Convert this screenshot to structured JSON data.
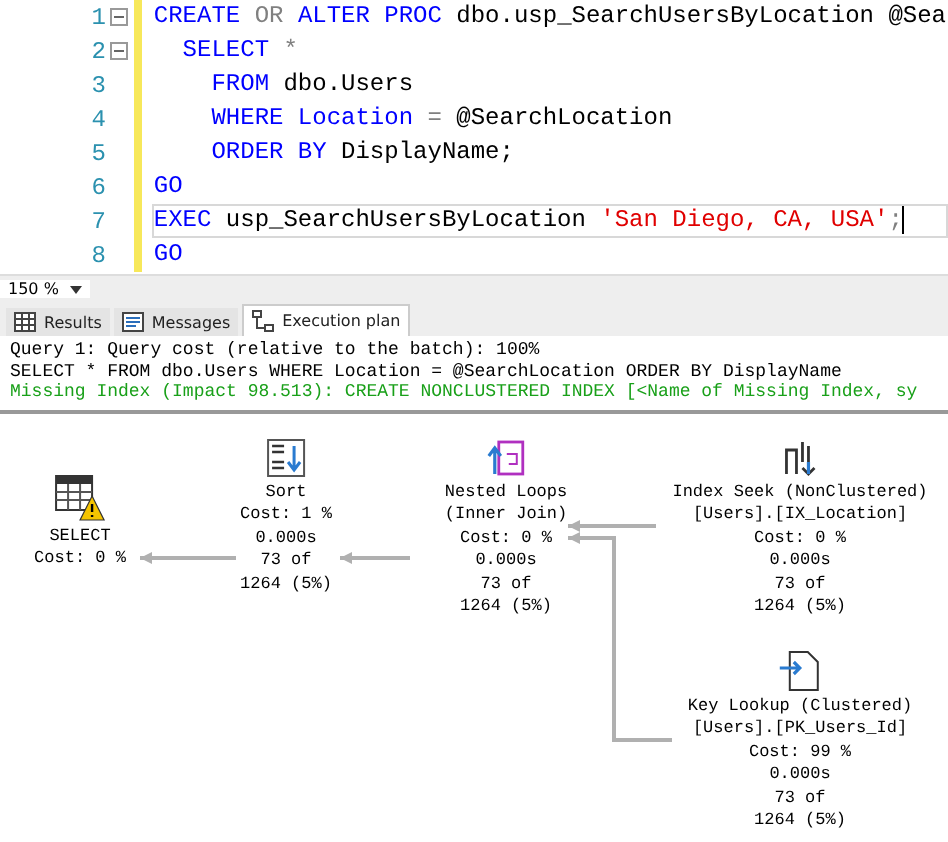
{
  "editor": {
    "lines": [
      {
        "number": "1",
        "fold": true,
        "current": false,
        "tokens": [
          {
            "kind": "keyword",
            "text": "CREATE"
          },
          {
            "kind": "operator",
            "text": " OR "
          },
          {
            "kind": "keyword",
            "text": "ALTER PROC"
          },
          {
            "kind": "plain",
            "text": " dbo.usp_SearchUsersByLocation @Sea"
          }
        ]
      },
      {
        "number": "2",
        "fold": true,
        "current": false,
        "tokens": [
          {
            "kind": "keyword",
            "text": "  SELECT"
          },
          {
            "kind": "operator",
            "text": " *"
          }
        ]
      },
      {
        "number": "3",
        "fold": false,
        "current": false,
        "tokens": [
          {
            "kind": "keyword",
            "text": "    FROM"
          },
          {
            "kind": "plain",
            "text": " dbo.Users"
          }
        ]
      },
      {
        "number": "4",
        "fold": false,
        "current": false,
        "tokens": [
          {
            "kind": "keyword",
            "text": "    WHERE Location"
          },
          {
            "kind": "operator",
            "text": " = "
          },
          {
            "kind": "plain",
            "text": "@SearchLocation"
          }
        ]
      },
      {
        "number": "5",
        "fold": false,
        "current": false,
        "tokens": [
          {
            "kind": "keyword",
            "text": "    ORDER BY"
          },
          {
            "kind": "plain",
            "text": " DisplayName;"
          }
        ]
      },
      {
        "number": "6",
        "fold": false,
        "current": false,
        "tokens": [
          {
            "kind": "keyword",
            "text": "GO"
          }
        ]
      },
      {
        "number": "7",
        "fold": false,
        "current": true,
        "tokens": [
          {
            "kind": "keyword",
            "text": "EXEC"
          },
          {
            "kind": "plain",
            "text": " usp_SearchUsersByLocation "
          },
          {
            "kind": "string",
            "text": "'San Diego, CA, USA'"
          },
          {
            "kind": "operator",
            "text": ";"
          }
        ]
      },
      {
        "number": "8",
        "fold": false,
        "current": false,
        "tokens": [
          {
            "kind": "keyword",
            "text": "GO"
          }
        ]
      }
    ]
  },
  "zoom": {
    "value": "150 %"
  },
  "tabs": [
    {
      "label": "Results",
      "selected": false
    },
    {
      "label": "Messages",
      "selected": false
    },
    {
      "label": "Execution plan",
      "selected": true
    }
  ],
  "plan_header": [
    {
      "kind": "plain",
      "text": "Query 1: Query cost (relative to the batch): 100%"
    },
    {
      "kind": "plain",
      "text": "SELECT * FROM dbo.Users WHERE Location = @SearchLocation ORDER BY DisplayName"
    },
    {
      "kind": "hint",
      "text": "Missing Index (Impact 98.513): CREATE NONCLUSTERED INDEX [<Name of Missing Index, sy"
    }
  ],
  "plan_nodes": [
    {
      "kind": "select",
      "warning": true,
      "lines": [
        "SELECT",
        "Cost: 0 %"
      ]
    },
    {
      "kind": "sort",
      "warning": false,
      "lines": [
        "Sort",
        "Cost: 1 %",
        "0.000s",
        "73 of",
        "1264 (5%)"
      ]
    },
    {
      "kind": "nested-loops",
      "warning": false,
      "lines": [
        "Nested Loops",
        "(Inner Join)",
        "Cost: 0 %",
        "0.000s",
        "73 of",
        "1264 (5%)"
      ]
    },
    {
      "kind": "index-seek",
      "warning": false,
      "lines": [
        "Index Seek (NonClustered)",
        "[Users].[IX_Location]",
        "Cost: 0 %",
        "0.000s",
        "73 of",
        "1264 (5%)"
      ]
    },
    {
      "kind": "key-lookup",
      "warning": false,
      "lines": [
        "Key Lookup (Clustered)",
        "[Users].[PK_Users_Id]",
        "Cost: 99 %",
        "0.000s",
        "73 of",
        "1264 (5%)"
      ]
    }
  ]
}
